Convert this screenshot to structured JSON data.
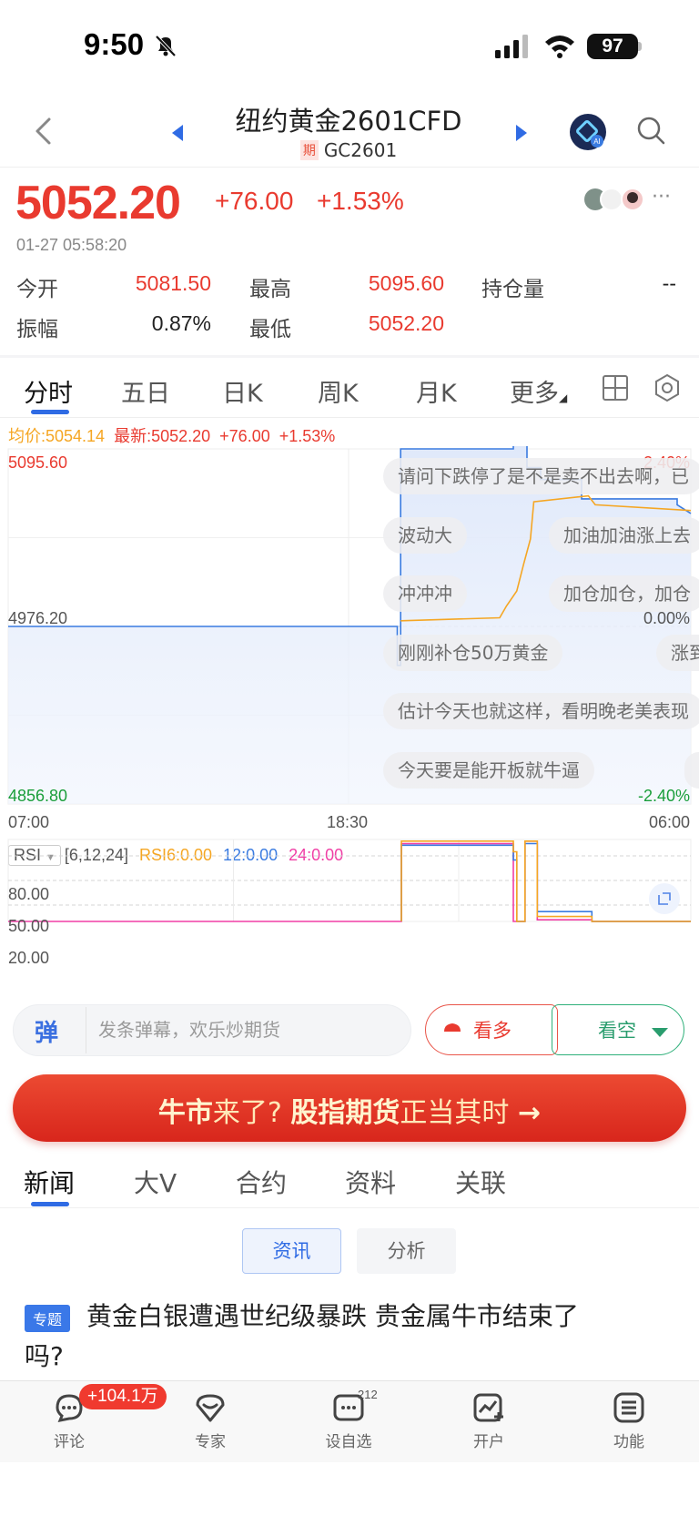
{
  "status_bar": {
    "time": "9:50",
    "battery": "97"
  },
  "header": {
    "title": "纽约黄金2601CFD",
    "subtitle_badge": "期",
    "subtitle": "GC2601"
  },
  "quote": {
    "price": "5052.20",
    "change": "+76.00",
    "change_pct": "+1.53%",
    "timestamp": "01-27 05:58:20",
    "more": "···"
  },
  "stats": {
    "open_label": "今开",
    "open_value": "5081.50",
    "high_label": "最高",
    "high_value": "5095.60",
    "oi_label": "持仓量",
    "oi_value": "--",
    "amp_label": "振幅",
    "amp_value": "0.87%",
    "low_label": "最低",
    "low_value": "5052.20"
  },
  "chart_tabs": [
    "分时",
    "五日",
    "日K",
    "周K",
    "月K",
    "更多"
  ],
  "legend": {
    "avg": "均价:5054.14",
    "latest": "最新:5052.20",
    "change": "+76.00",
    "pct": "+1.53%"
  },
  "axis": {
    "y_top": "5095.60",
    "y_mid": "4976.20",
    "y_bottom": "4856.80",
    "pct_top": "2.40%",
    "pct_mid": "0.00%",
    "pct_bottom": "-2.40%",
    "x_start": "07:00",
    "x_mid": "18:30",
    "x_end": "06:00"
  },
  "danmaku": [
    "请问下跌停了是不是卖不出去啊，已",
    "波动大",
    "加油加油涨上去",
    "冲冲冲",
    "加仓加仓，加仓",
    "刚刚补仓50万黄金",
    "涨到",
    "估计今天也就这样，看明晚老美表现",
    "今天要是能开板就牛逼"
  ],
  "rsi": {
    "selector": "RSI",
    "params": "[6,12,24]",
    "rsi6": "RSI6:0.00",
    "rsi12": "12:0.00",
    "rsi24": "24:0.00",
    "levels": [
      "80.00",
      "50.00",
      "20.00"
    ]
  },
  "actions": {
    "danmaku_icon": "弹",
    "danmaku_placeholder": "发条弹幕，欢乐炒期货",
    "bull": "看多",
    "bear": "看空"
  },
  "banner": {
    "part1": "牛市",
    "part2": "来了?",
    "part3": "股指期货",
    "part4": "正当其时",
    "arrow": "→"
  },
  "news_tabs": [
    "新闻",
    "大V",
    "合约",
    "资料",
    "关联"
  ],
  "sub_tabs": [
    "资讯",
    "分析"
  ],
  "news": {
    "tag": "专题",
    "title": "黄金白银遭遇世纪级暴跌 贵金属牛市结束了吗?"
  },
  "bottom_nav": {
    "comment": "评论",
    "comment_badge": "+104.1万",
    "expert": "专家",
    "watchlist": "设自选",
    "watch_count": "212",
    "open_account": "开户",
    "functions": "功能"
  },
  "colors": {
    "up": "#e93a2f",
    "down": "#1a9e3a",
    "price_line": "#3a7be0",
    "avg_line": "#f5a623",
    "rsi12": "#3a7be0",
    "rsi24": "#f03ea5",
    "accent": "#2f6be4"
  },
  "chart_data": [
    {
      "type": "line",
      "title": "",
      "x_ticks": [
        "07:00",
        "18:30",
        "06:00"
      ],
      "y_ticks": [
        "4856.80",
        "4976.20",
        "5095.60"
      ],
      "ylim": [
        4856.8,
        5095.6
      ],
      "series": [
        {
          "name": "最新",
          "x": [
            0,
            0.57,
            0.57,
            0.575,
            0.575,
            0.74,
            0.74,
            0.76,
            0.76,
            0.78,
            0.78,
            0.84,
            0.84,
            0.98,
            0.98,
            1.0
          ],
          "values": [
            4976.2,
            4976.2,
            4950,
            4950,
            5095.6,
            5095.6,
            5100.2,
            5100.2,
            5083,
            5083,
            5075,
            5075,
            5062,
            5062,
            5058,
            5052.2
          ]
        },
        {
          "name": "均价",
          "x": [
            0.575,
            0.72,
            0.73,
            0.745,
            0.755,
            0.765,
            0.77,
            0.85,
            0.86,
            1.0
          ],
          "values": [
            4980,
            4982,
            4990,
            5000,
            5018,
            5035,
            5060,
            5064,
            5058,
            5054.14
          ]
        }
      ]
    },
    {
      "type": "line",
      "title": "",
      "y_ticks": [
        "20.00",
        "50.00",
        "80.00"
      ],
      "ylim": [
        0,
        100
      ],
      "series": [
        {
          "name": "RSI6",
          "values": [
            0.0
          ]
        },
        {
          "name": "12",
          "values": [
            0.0
          ]
        },
        {
          "name": "24",
          "values": [
            0.0
          ]
        }
      ]
    }
  ]
}
